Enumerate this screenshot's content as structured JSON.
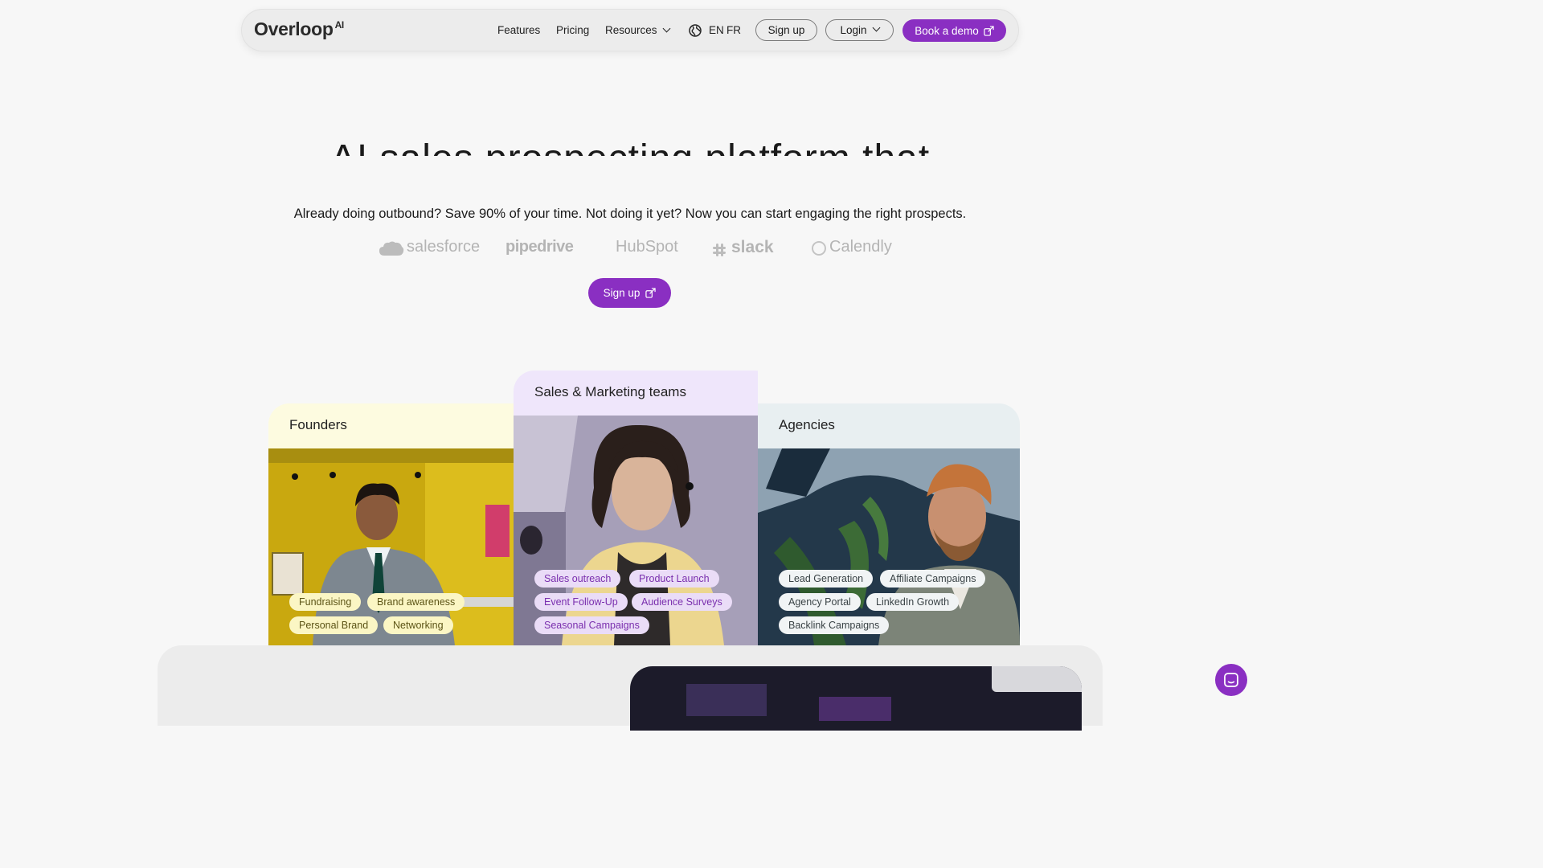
{
  "nav": {
    "logo": "Overloop",
    "logo_suffix": "AI",
    "links": [
      "Features",
      "Pricing",
      "Resources"
    ],
    "lang_en": "EN",
    "lang_fr": "FR",
    "signup": "Sign up",
    "login": "Login",
    "demo": "Book a demo"
  },
  "hero": {
    "title_partial": "AI sales prospecting platform that",
    "subtitle": "Already doing outbound? Save 90% of your time. Not doing it yet? Now you can start engaging the right prospects.",
    "signup": "Sign up"
  },
  "integrations": [
    "salesforce",
    "pipedrive",
    "HubSpot",
    "slack",
    "Calendly"
  ],
  "cards": {
    "founders": {
      "title": "Founders",
      "tags": [
        "Fundraising",
        "Brand awareness",
        "Personal Brand",
        "Networking"
      ]
    },
    "sales": {
      "title": "Sales & Marketing teams",
      "tags": [
        "Sales outreach",
        "Product Launch",
        "Event Follow-Up",
        "Audience Surveys",
        "Seasonal Campaigns"
      ]
    },
    "agencies": {
      "title": "Agencies",
      "tags": [
        "Lead Generation",
        "Affiliate Campaigns",
        "Agency Portal",
        "LinkedIn Growth",
        "Backlink Campaigns"
      ]
    }
  },
  "colors": {
    "accent": "#8a2fc2",
    "founders_bg": "#fdfbe0",
    "sales_bg": "#efe6fb",
    "agencies_bg": "#e8eff1"
  }
}
